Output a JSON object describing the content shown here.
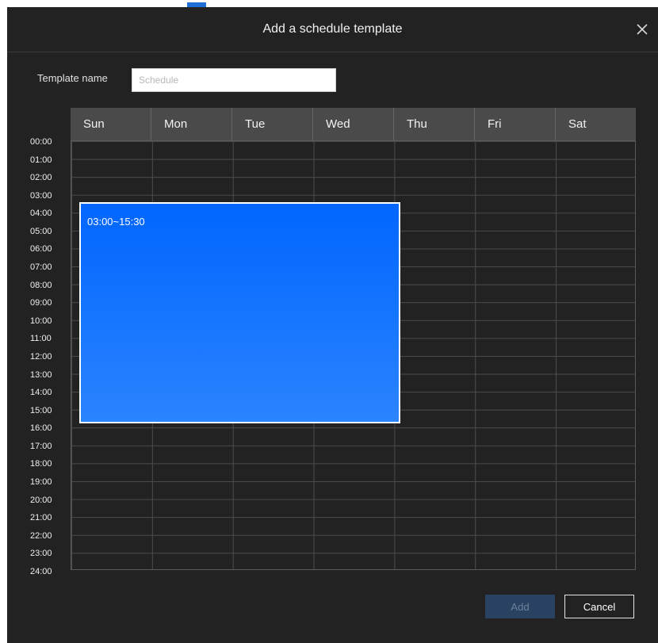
{
  "dialog": {
    "title": "Add a schedule template",
    "close_icon": "close-icon"
  },
  "template_name": {
    "label": "Template name",
    "value": "",
    "placeholder": "Schedule"
  },
  "grid": {
    "days": [
      "Sun",
      "Mon",
      "Tue",
      "Wed",
      "Thu",
      "Fri",
      "Sat"
    ],
    "hours": [
      "00:00",
      "01:00",
      "02:00",
      "03:00",
      "04:00",
      "05:00",
      "06:00",
      "07:00",
      "08:00",
      "09:00",
      "10:00",
      "11:00",
      "12:00",
      "13:00",
      "14:00",
      "15:00",
      "16:00",
      "17:00",
      "18:00",
      "19:00",
      "20:00",
      "21:00",
      "22:00",
      "23:00",
      "24:00"
    ]
  },
  "schedule_block": {
    "label": "03:00~15:30",
    "start": "03:00",
    "end": "15:30",
    "days": [
      "Sun",
      "Mon",
      "Tue",
      "Wed"
    ],
    "color": "#0066ff"
  },
  "actions": {
    "add_label": "Add",
    "add_enabled": false,
    "cancel_label": "Cancel"
  },
  "colors": {
    "dialog_bg": "#222222",
    "header_row_bg": "#4a4a4a",
    "accent": "#0066ff"
  }
}
